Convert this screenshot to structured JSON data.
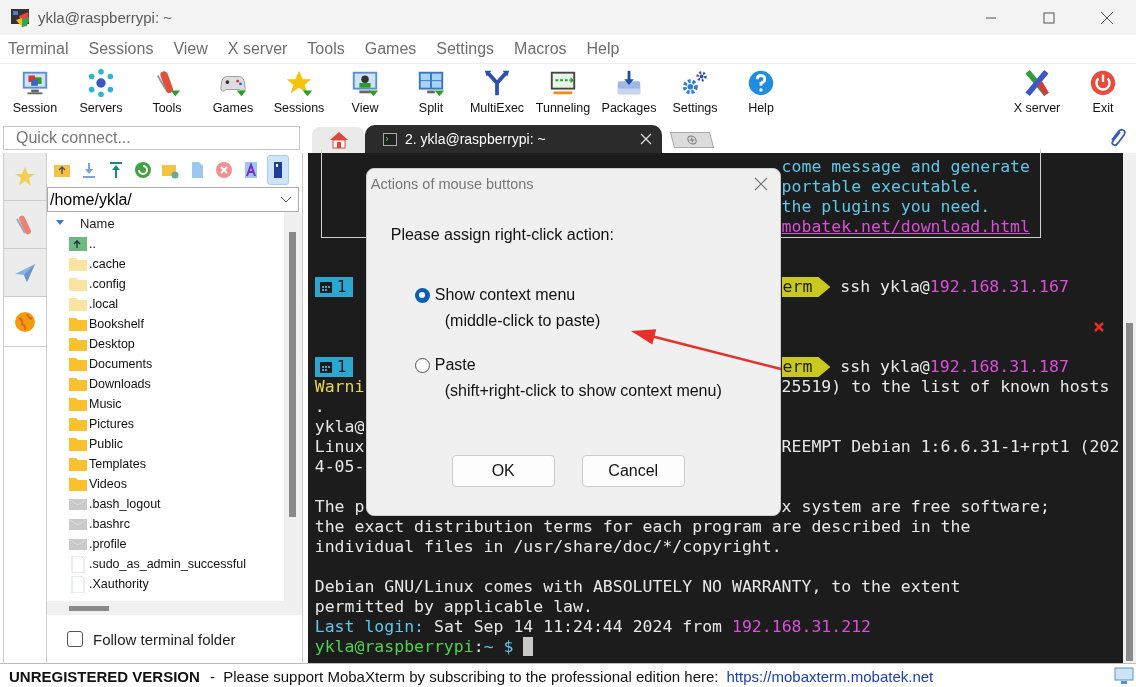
{
  "window": {
    "title": "ykla@raspberrypi: ~"
  },
  "menu": [
    "Terminal",
    "Sessions",
    "View",
    "X server",
    "Tools",
    "Games",
    "Settings",
    "Macros",
    "Help"
  ],
  "toolbar": [
    {
      "label": "Session",
      "kind": "session"
    },
    {
      "label": "Servers",
      "kind": "servers"
    },
    {
      "label": "Tools",
      "kind": "tools"
    },
    {
      "label": "Games",
      "kind": "games"
    },
    {
      "label": "Sessions",
      "kind": "star"
    },
    {
      "label": "View",
      "kind": "view"
    },
    {
      "label": "Split",
      "kind": "split"
    },
    {
      "label": "MultiExec",
      "kind": "fork"
    },
    {
      "label": "Tunneling",
      "kind": "tunnel"
    },
    {
      "label": "Packages",
      "kind": "packages"
    },
    {
      "label": "Settings",
      "kind": "gears"
    },
    {
      "label": "Help",
      "kind": "help"
    }
  ],
  "toolbar_right": [
    {
      "label": "X server",
      "kind": "xlogo"
    },
    {
      "label": "Exit",
      "kind": "power"
    }
  ],
  "quick_connect": {
    "placeholder": "Quick connect..."
  },
  "tabs": [
    {
      "kind": "home",
      "selected": false
    },
    {
      "kind": "terminal",
      "label": "2. ykla@raspberrypi: ~",
      "selected": true
    },
    {
      "kind": "new",
      "selected": false
    }
  ],
  "side_tabs": [
    {
      "kind": "star",
      "selected": false
    },
    {
      "kind": "tools",
      "selected": false
    },
    {
      "kind": "send",
      "selected": false
    },
    {
      "kind": "globe",
      "selected": true
    }
  ],
  "sftp": {
    "toolbar": [
      {
        "kind": "up",
        "selected": false
      },
      {
        "kind": "download",
        "selected": false
      },
      {
        "kind": "upload",
        "selected": false
      },
      {
        "kind": "refresh",
        "selected": false
      },
      {
        "kind": "newfolder",
        "selected": false
      },
      {
        "kind": "newfile",
        "selected": false
      },
      {
        "kind": "delete",
        "selected": false
      },
      {
        "kind": "rename",
        "selected": false
      },
      {
        "kind": "follow",
        "selected": true
      }
    ],
    "path": "/home/ykla/",
    "column": "Name",
    "files": [
      {
        "name": "..",
        "kind": "up"
      },
      {
        "name": ".cache",
        "kind": "hidden"
      },
      {
        "name": ".config",
        "kind": "hidden"
      },
      {
        "name": ".local",
        "kind": "hidden"
      },
      {
        "name": "Bookshelf",
        "kind": "folder"
      },
      {
        "name": "Desktop",
        "kind": "folder"
      },
      {
        "name": "Documents",
        "kind": "folder"
      },
      {
        "name": "Downloads",
        "kind": "folder"
      },
      {
        "name": "Music",
        "kind": "folder"
      },
      {
        "name": "Pictures",
        "kind": "folder"
      },
      {
        "name": "Public",
        "kind": "folder"
      },
      {
        "name": "Templates",
        "kind": "folder"
      },
      {
        "name": "Videos",
        "kind": "folder"
      },
      {
        "name": ".bash_logout",
        "kind": "dotfile"
      },
      {
        "name": ".bashrc",
        "kind": "dotfile"
      },
      {
        "name": ".profile",
        "kind": "dotfile"
      },
      {
        "name": ".sudo_as_admin_successful",
        "kind": "file"
      },
      {
        "name": ".Xauthority",
        "kind": "file"
      }
    ],
    "follow_terminal_folder": {
      "label": "Follow terminal folder",
      "checked": false
    }
  },
  "terminal": {
    "banner": [
      {
        "right": [
          {
            "text": "come message and generate",
            "color": "#5fc8e8"
          }
        ]
      },
      {
        "right": [
          {
            "text": "portable executable.",
            "color": "#5fc8e8"
          }
        ]
      },
      {
        "right": [
          {
            "text": "the plugins you need.",
            "color": "#5fc8e8"
          }
        ]
      },
      {
        "right": [
          {
            "text": "mobatek.net/download.html",
            "color": "#d94fd9",
            "kind": "link"
          }
        ]
      }
    ],
    "lines": [
      {
        "kind": "blank"
      },
      {
        "kind": "blank"
      },
      {
        "kind": "prompt",
        "left": [
          {
            "text": "1",
            "color": "#2aa8d0",
            "kind": "badge"
          }
        ],
        "right": [
          {
            "text": "erm",
            "color": "#c8c81e",
            "kind": "badge"
          },
          {
            "text": " ssh ykla@",
            "color": "#e8e8e8"
          },
          {
            "text": "192.168.31.167",
            "color": "#d94fd9"
          }
        ]
      },
      {
        "kind": "blank"
      },
      {
        "kind": "error"
      },
      {
        "kind": "blank"
      },
      {
        "kind": "prompt",
        "left": [
          {
            "text": "1",
            "color": "#2aa8d0",
            "kind": "badge"
          }
        ],
        "right": [
          {
            "text": "erm",
            "color": "#c8c81e",
            "kind": "badge"
          },
          {
            "text": " ssh ykla@",
            "color": "#e8e8e8"
          },
          {
            "text": "192.168.31.187",
            "color": "#d94fd9"
          }
        ]
      },
      {
        "kind": "text",
        "left": [
          {
            "text": "Warni",
            "color": "#e6d84c"
          }
        ],
        "right": [
          {
            "text": "25519) to the list of known hosts",
            "color": "#e8e8e8"
          }
        ]
      },
      {
        "kind": "text",
        "left": [
          {
            "text": "."
          }
        ]
      },
      {
        "kind": "text",
        "left": [
          {
            "text": "ykla@",
            "color": "#e8e8e8"
          }
        ]
      },
      {
        "kind": "text",
        "left": [
          {
            "text": "Linux",
            "color": "#e8e8e8"
          }
        ],
        "right": [
          {
            "text": "REEMPT Debian 1:6.6.31-1+rpt1 (202",
            "color": "#e8e8e8"
          }
        ]
      },
      {
        "kind": "text",
        "left": [
          {
            "text": "4-05-",
            "color": "#e8e8e8"
          }
        ]
      },
      {
        "kind": "blank"
      },
      {
        "kind": "text",
        "left": [
          {
            "text": "The p",
            "color": "#e8e8e8"
          }
        ],
        "right": [
          {
            "text": "x system are free software;",
            "color": "#e8e8e8"
          }
        ]
      },
      {
        "kind": "text",
        "left": [
          {
            "text": "the exact distribution terms for each program are described in the",
            "color": "#e8e8e8"
          }
        ]
      },
      {
        "kind": "text",
        "left": [
          {
            "text": "individual files in /usr/share/doc/*/copyright.",
            "color": "#e8e8e8"
          }
        ]
      },
      {
        "kind": "blank"
      },
      {
        "kind": "text",
        "left": [
          {
            "text": "Debian GNU/Linux comes with ABSOLUTELY NO WARRANTY, to the extent",
            "color": "#e8e8e8"
          }
        ]
      },
      {
        "kind": "text",
        "left": [
          {
            "text": "permitted by applicable law.",
            "color": "#e8e8e8"
          }
        ]
      },
      {
        "kind": "text",
        "left": [
          {
            "text": "Last login:",
            "color": "#5fc8e8"
          },
          {
            "text": " Sat Sep 14 11:24:44 2024 from ",
            "color": "#e8e8e8"
          },
          {
            "text": "192.168.31.212",
            "color": "#d94fd9"
          }
        ]
      },
      {
        "kind": "input",
        "left": [
          {
            "text": "ykla@raspberrypi",
            "color": "#4ed24e"
          },
          {
            "text": ":",
            "color": "#e8e8e8"
          },
          {
            "text": "~ $",
            "color": "#5fc8e8"
          }
        ]
      }
    ]
  },
  "dialog": {
    "title": "Actions of mouse buttons",
    "prompt": "Please assign right-click action:",
    "options": [
      {
        "label": "Show context menu",
        "hint": "(middle-click to paste)",
        "selected": true
      },
      {
        "label": "Paste",
        "hint": "(shift+right-click to show context menu)",
        "selected": false
      }
    ],
    "buttons": [
      "OK",
      "Cancel"
    ]
  },
  "status_bar": {
    "badge": "UNREGISTERED VERSION",
    "message": "-  Please support MobaXterm by subscribing to the professional edition here:",
    "link": "https://mobaxterm.mobatek.net"
  }
}
